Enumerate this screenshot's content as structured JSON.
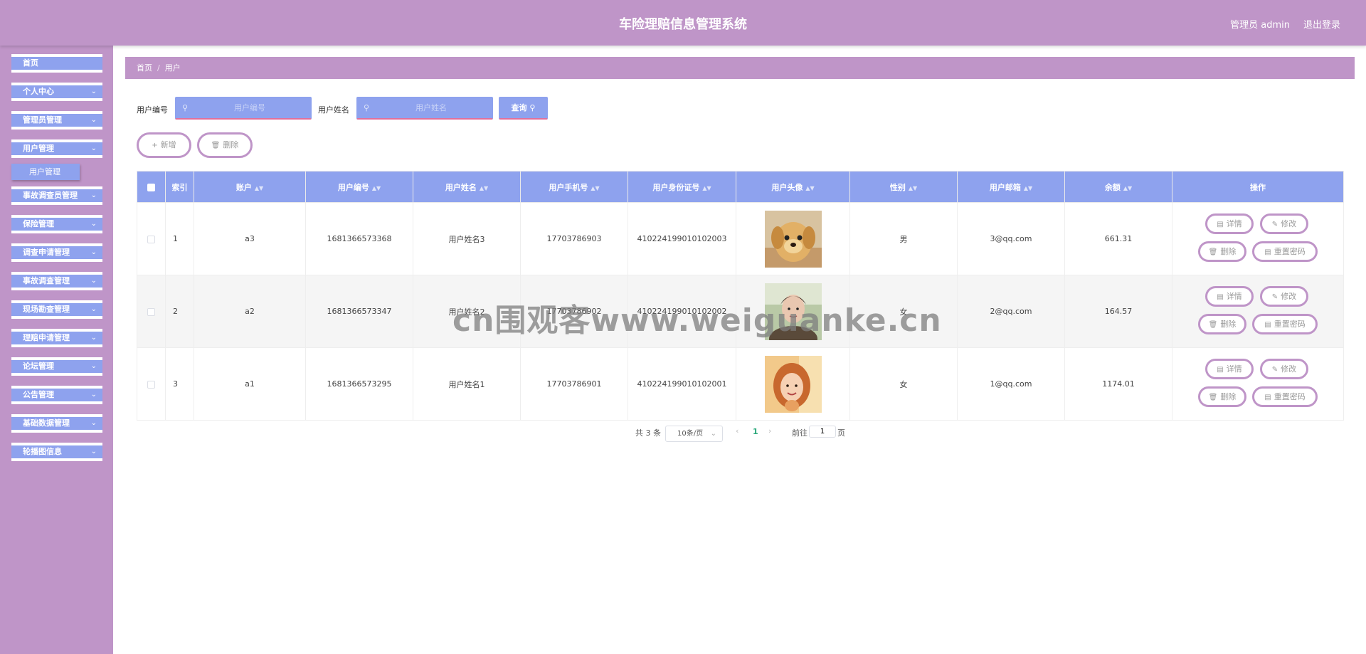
{
  "header": {
    "title": "车险理赔信息管理系统",
    "admin_label": "管理员 admin",
    "logout_label": "退出登录"
  },
  "sidebar": {
    "items": [
      {
        "label": "首页",
        "has_children": false
      },
      {
        "label": "个人中心",
        "has_children": true
      },
      {
        "label": "管理员管理",
        "has_children": true
      },
      {
        "label": "用户管理",
        "has_children": true
      },
      {
        "label": "事故调查员管理",
        "has_children": true
      },
      {
        "label": "保险管理",
        "has_children": true
      },
      {
        "label": "调查申请管理",
        "has_children": true
      },
      {
        "label": "事故调查管理",
        "has_children": true
      },
      {
        "label": "现场勘查管理",
        "has_children": true
      },
      {
        "label": "理赔申请管理",
        "has_children": true
      },
      {
        "label": "论坛管理",
        "has_children": true
      },
      {
        "label": "公告管理",
        "has_children": true
      },
      {
        "label": "基础数据管理",
        "has_children": true
      },
      {
        "label": "轮播图信息",
        "has_children": true
      }
    ],
    "submenu": {
      "label": "用户管理"
    }
  },
  "breadcrumb": {
    "home": "首页",
    "separator": "/",
    "current": "用户"
  },
  "search": {
    "user_no_label": "用户编号",
    "user_no_placeholder": "用户编号",
    "user_no_value": "",
    "user_name_label": "用户姓名",
    "user_name_placeholder": "用户姓名",
    "user_name_value": "",
    "query_label": "查询"
  },
  "toolbar": {
    "add_label": "新增",
    "delete_label": "删除"
  },
  "table": {
    "columns": [
      "索引",
      "账户",
      "用户编号",
      "用户姓名",
      "用户手机号",
      "用户身份证号",
      "用户头像",
      "性别",
      "用户邮箱",
      "余额",
      "操作"
    ],
    "rows": [
      {
        "index": "1",
        "account": "a3",
        "user_no": "1681366573368",
        "name": "用户姓名3",
        "phone": "17703786903",
        "id_card": "410224199010102003",
        "gender": "男",
        "email": "3@qq.com",
        "balance": "661.31"
      },
      {
        "index": "2",
        "account": "a2",
        "user_no": "1681366573347",
        "name": "用户姓名2",
        "phone": "17703786902",
        "id_card": "410224199010102002",
        "gender": "女",
        "email": "2@qq.com",
        "balance": "164.57"
      },
      {
        "index": "3",
        "account": "a1",
        "user_no": "1681366573295",
        "name": "用户姓名1",
        "phone": "17703786901",
        "id_card": "410224199010102001",
        "gender": "女",
        "email": "1@qq.com",
        "balance": "1174.01"
      }
    ],
    "actions": {
      "detail": "详情",
      "edit": "修改",
      "delete": "删除",
      "reset_pwd": "重置密码"
    }
  },
  "pagination": {
    "total": "共 3 条",
    "page_size": "10条/页",
    "current_page": "1",
    "goto_label": "前往",
    "goto_value": "1",
    "page_unit": "页"
  },
  "watermark": "cn围观客www.weiguanke.cn",
  "colors": {
    "header": "#bf95c8",
    "accent_blue": "#8ea2ee",
    "pill_border": "#bf95c8",
    "underline_pink": "#e16f9b"
  },
  "icons": {
    "search": "search-icon",
    "chevron": "chevron-down-icon",
    "add": "plus-icon",
    "delete": "trash-icon",
    "detail": "document-icon",
    "edit": "pencil-icon",
    "sort": "sort-icon",
    "prev": "chevron-left-icon",
    "next": "chevron-right-icon"
  }
}
